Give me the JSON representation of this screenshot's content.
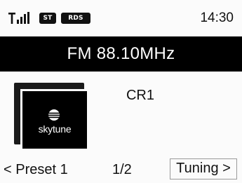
{
  "status_bar": {
    "signal_icon": "antenna-signal-icon",
    "badges": [
      "ST",
      "RDS"
    ],
    "time": "14:30"
  },
  "tuner": {
    "frequency": "FM 88.10MHz"
  },
  "station": {
    "logo_icon": "skytune-logo-icon",
    "logo_text": "skytune",
    "name": "CR1"
  },
  "nav": {
    "prev_label": "< Preset 1",
    "page": "1/2",
    "next_label": "Tuning >"
  },
  "colors": {
    "background": "#fbfbfb",
    "bar": "#000000",
    "text": "#111111",
    "inverse_text": "#ffffff"
  }
}
